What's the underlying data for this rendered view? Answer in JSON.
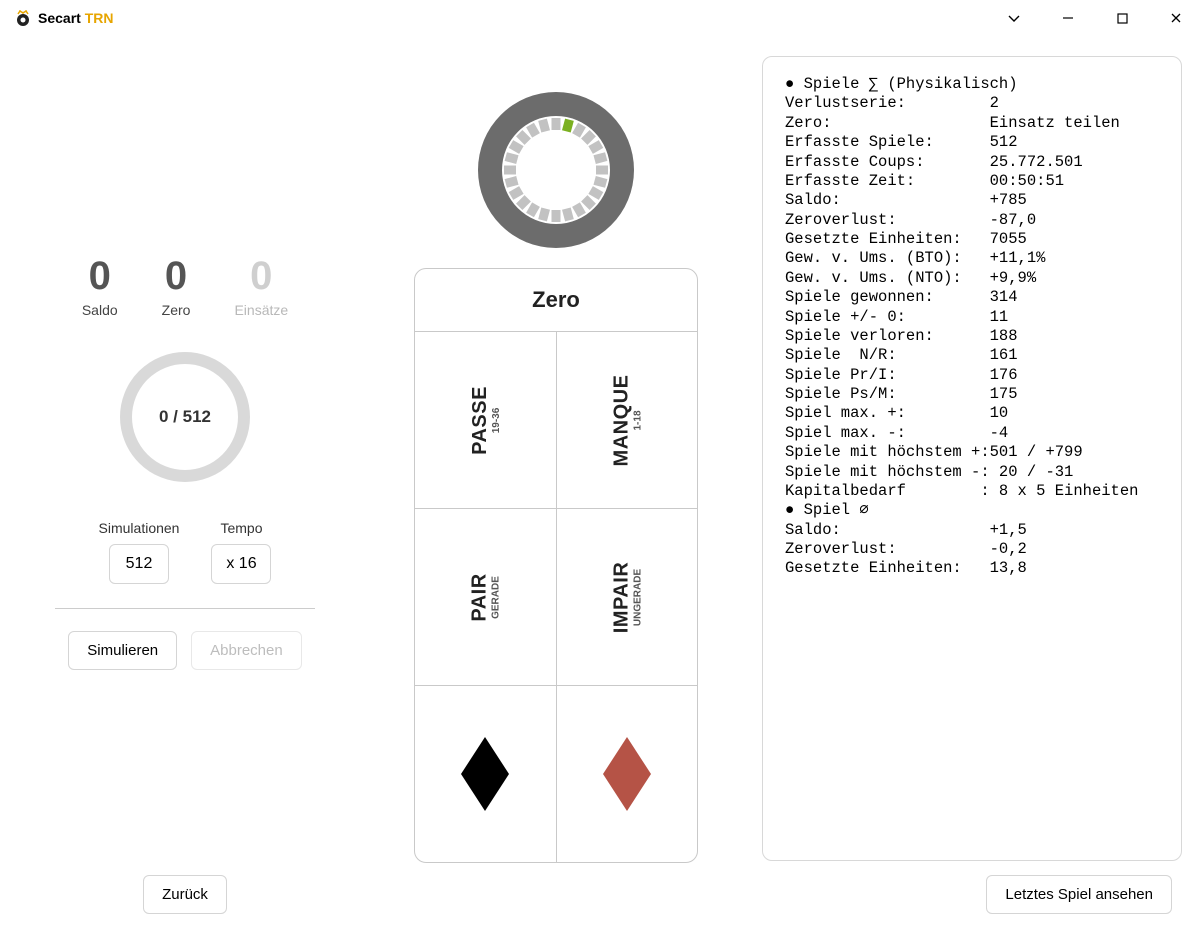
{
  "app": {
    "name1": "Secart",
    "name2": "TRN"
  },
  "counters": {
    "saldo": {
      "value": "0",
      "label": "Saldo"
    },
    "zero": {
      "value": "0",
      "label": "Zero"
    },
    "einsaetze": {
      "value": "0",
      "label": "Einsätze"
    }
  },
  "ring": {
    "text": "0 / 512"
  },
  "controls": {
    "sim_label": "Simulationen",
    "sim_value": "512",
    "tempo_label": "Tempo",
    "tempo_value": "x 16",
    "btn_simulate": "Simulieren",
    "btn_cancel": "Abbrechen",
    "btn_back": "Zurück"
  },
  "board": {
    "zero": "Zero",
    "passe": "PASSE",
    "passe_sub": "19-36",
    "manque": "MANQUE",
    "manque_sub": "1-18",
    "pair": "PAIR",
    "pair_sub": "GERADE",
    "impair": "IMPAIR",
    "impair_sub": "UNGERADE",
    "noir_color": "#000000",
    "rouge_color": "#b55346"
  },
  "stats": {
    "header": "● Spiele ∑ (Physikalisch)",
    "rows1": [
      [
        "Verlustserie:",
        "2"
      ],
      [
        "Zero:",
        "Einsatz teilen"
      ]
    ],
    "rows2": [
      [
        "Erfasste Spiele:",
        "512"
      ],
      [
        "Erfasste Coups:",
        "25.772.501"
      ],
      [
        "Erfasste Zeit:",
        "00:50:51"
      ]
    ],
    "rows3": [
      [
        "Saldo:",
        "+785"
      ],
      [
        "Zeroverlust:",
        "-87,0"
      ],
      [
        "Gesetzte Einheiten:",
        "7055"
      ]
    ],
    "rows4": [
      [
        "Gew. v. Ums. (BTO):",
        "+11,1%"
      ],
      [
        "Gew. v. Ums. (NTO):",
        "+9,9%"
      ]
    ],
    "rows5": [
      [
        "Spiele gewonnen:",
        "314"
      ],
      [
        "Spiele +/- 0:",
        "11"
      ],
      [
        "Spiele verloren:",
        "188"
      ]
    ],
    "rows6": [
      [
        "Spiele  N/R:",
        "161"
      ],
      [
        "Spiele Pr/I:",
        "176"
      ],
      [
        "Spiele Ps/M:",
        "175"
      ]
    ],
    "rows7": [
      [
        "Spiel max. +:",
        "10"
      ],
      [
        "Spiel max. -:",
        "-4"
      ]
    ],
    "rows8": [
      [
        "Spiele mit höchstem +:",
        "501 / +799"
      ],
      [
        "Spiele mit höchstem -:",
        " 20 / -31"
      ]
    ],
    "single_kapital": "Kapitalbedarf        : 8 x 5 Einheiten",
    "header2": "● Spiel ∅",
    "rows9": [
      [
        "Saldo:",
        "+1,5"
      ],
      [
        "Zeroverlust:",
        "-0,2"
      ],
      [
        "Gesetzte Einheiten:",
        "13,8"
      ]
    ]
  },
  "btn_last_game": "Letztes Spiel ansehen"
}
